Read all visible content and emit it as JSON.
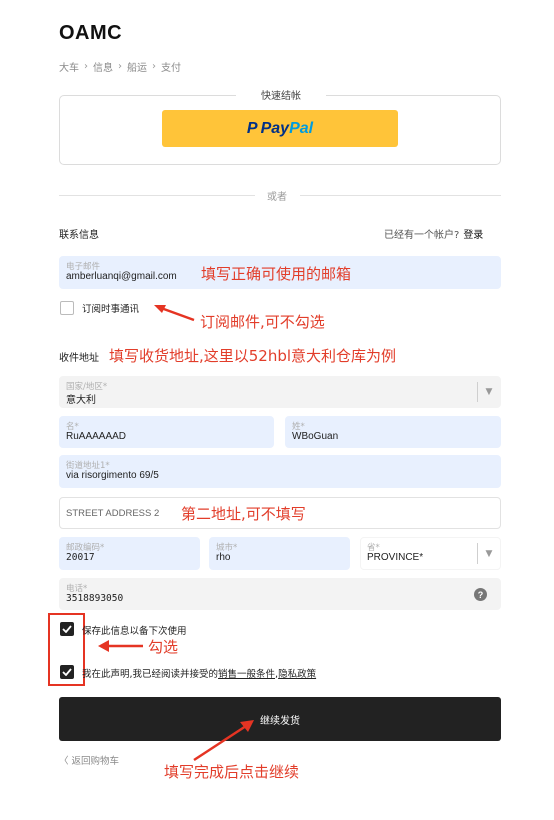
{
  "brand": "OAMC",
  "breadcrumb": [
    "大车",
    "信息",
    "船运",
    "支付"
  ],
  "breadcrumb_sep": "›",
  "express": {
    "title": "快速结帐",
    "paypal_p": "P",
    "paypal_pay": "Pay",
    "paypal_pal": "Pal"
  },
  "or_text": "或者",
  "contact": {
    "title": "联系信息",
    "login_hint": "已经有一个帐户?",
    "login_link": "登录",
    "email_label": "电子邮件",
    "email_value": "amberluanqi@gmail.com",
    "newsletter_label": "订阅时事通讯"
  },
  "shipping": {
    "title": "收件地址",
    "country_label": "国家/地区*",
    "country_value": "意大利",
    "first_name_label": "名*",
    "first_name_value": "RuAAAAAAD",
    "last_name_label": "姓*",
    "last_name_value": "WBoGuan",
    "address1_label": "街道地址1*",
    "address1_value": "via risorgimento 69/5",
    "address2_placeholder": "STREET ADDRESS 2",
    "postal_label": "邮政编码*",
    "postal_value": "20017",
    "city_label": "城市*",
    "city_value": "rho",
    "province_label": "省*",
    "province_value": "PROVINCE*",
    "phone_label": "电话*",
    "phone_value": "3518893050",
    "help_symbol": "?",
    "save_info_label": "保存此信息以备下次使用",
    "agree_prefix": "我在此声明,我已经阅读并接受的",
    "agree_terms": "销售一般条件",
    "agree_sep": ",",
    "agree_privacy": "隐私政策"
  },
  "continue_label": "继续发货",
  "back_label": "〈 返回购物车",
  "annotations": {
    "email_note": "填写正确可使用的邮箱",
    "newsletter_note": "订阅邮件,可不勾选",
    "address_note": "填写收货地址,这里以52hbl意大利仓库为例",
    "address2_note": "第二地址,可不填写",
    "check_note": "勾选",
    "continue_note": "填写完成后点击继续"
  },
  "colors": {
    "paypal_yellow": "#ffc439",
    "annotation_red": "#e23d2a",
    "autofill_blue": "#e8f0fe",
    "button_dark": "#222222"
  }
}
